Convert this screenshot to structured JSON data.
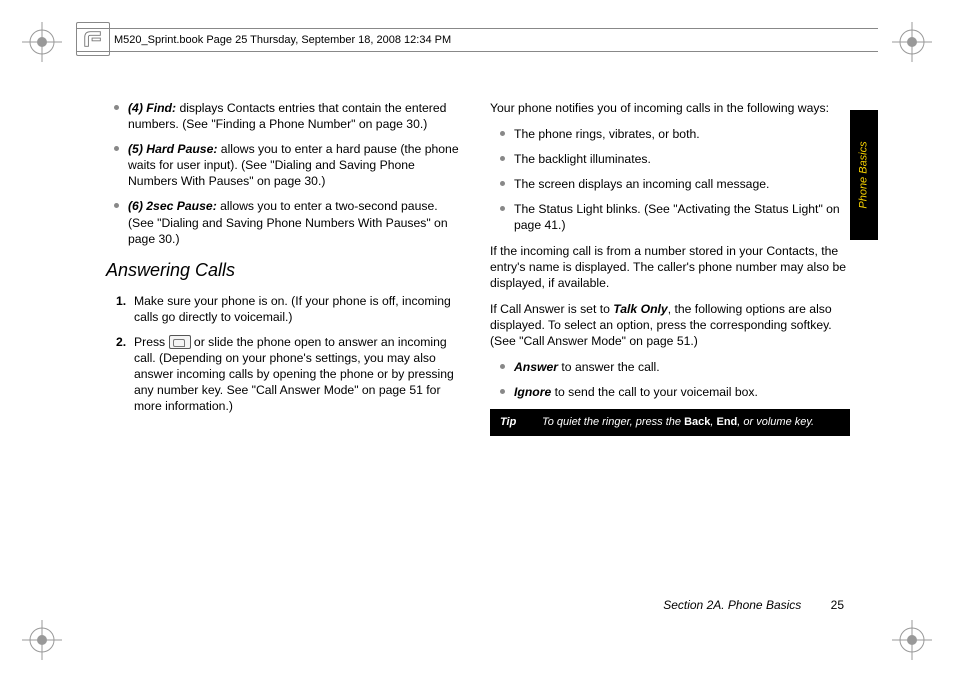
{
  "header": {
    "fileinfo": "M520_Sprint.book  Page 25  Thursday, September 18, 2008  12:34 PM"
  },
  "side_tab": "Phone Basics",
  "left_col": {
    "bullets": [
      {
        "label": "(4) Find:",
        "text": " displays Contacts entries that contain the entered numbers. (See \"Finding a Phone Number\" on page 30.)"
      },
      {
        "label": "(5) Hard Pause:",
        "text": " allows you to enter a hard pause (the phone waits for user input). (See \"Dialing and Saving Phone Numbers With Pauses\" on page 30.)"
      },
      {
        "label": "(6) 2sec Pause:",
        "text": " allows you to enter a two-second pause. (See \"Dialing and Saving Phone Numbers With Pauses\" on page 30.)"
      }
    ],
    "heading": "Answering Calls",
    "steps": [
      "Make sure your phone is on. (If your phone is off, incoming calls go directly to voicemail.)",
      "Press __ICON__ or slide the phone open to answer an incoming call. (Depending on your phone's settings, you may also answer incoming calls by opening the phone or by pressing any number key. See \"Call Answer Mode\" on page 51 for more information.)"
    ]
  },
  "right_col": {
    "intro": "Your phone notifies you of incoming calls in the following ways:",
    "bullets": [
      "The phone rings, vibrates, or both.",
      "The backlight illuminates.",
      "The screen displays an incoming call message.",
      "The Status Light blinks. (See \"Activating the Status Light\" on page 41.)"
    ],
    "para1": "If the incoming call is from a number stored in your Contacts, the entry's name is displayed. The caller's phone number may also be displayed, if available.",
    "para2_pre": "If Call Answer is set to ",
    "para2_em": "Talk Only",
    "para2_post": ", the following options are also displayed. To select an option, press the corresponding softkey. (See \"Call Answer Mode\" on page 51.)",
    "bullets2": [
      {
        "label": "Answer",
        "text": " to answer the call."
      },
      {
        "label": "Ignore",
        "text": " to send the call to your voicemail box."
      }
    ],
    "tip": {
      "label": "Tip",
      "text_pre": "To quiet the ringer, press the ",
      "b1": "Back",
      "mid": ", ",
      "b2": "End",
      "text_post": ", or volume key."
    }
  },
  "footer": {
    "section": "Section 2A. Phone Basics",
    "page": "25"
  }
}
